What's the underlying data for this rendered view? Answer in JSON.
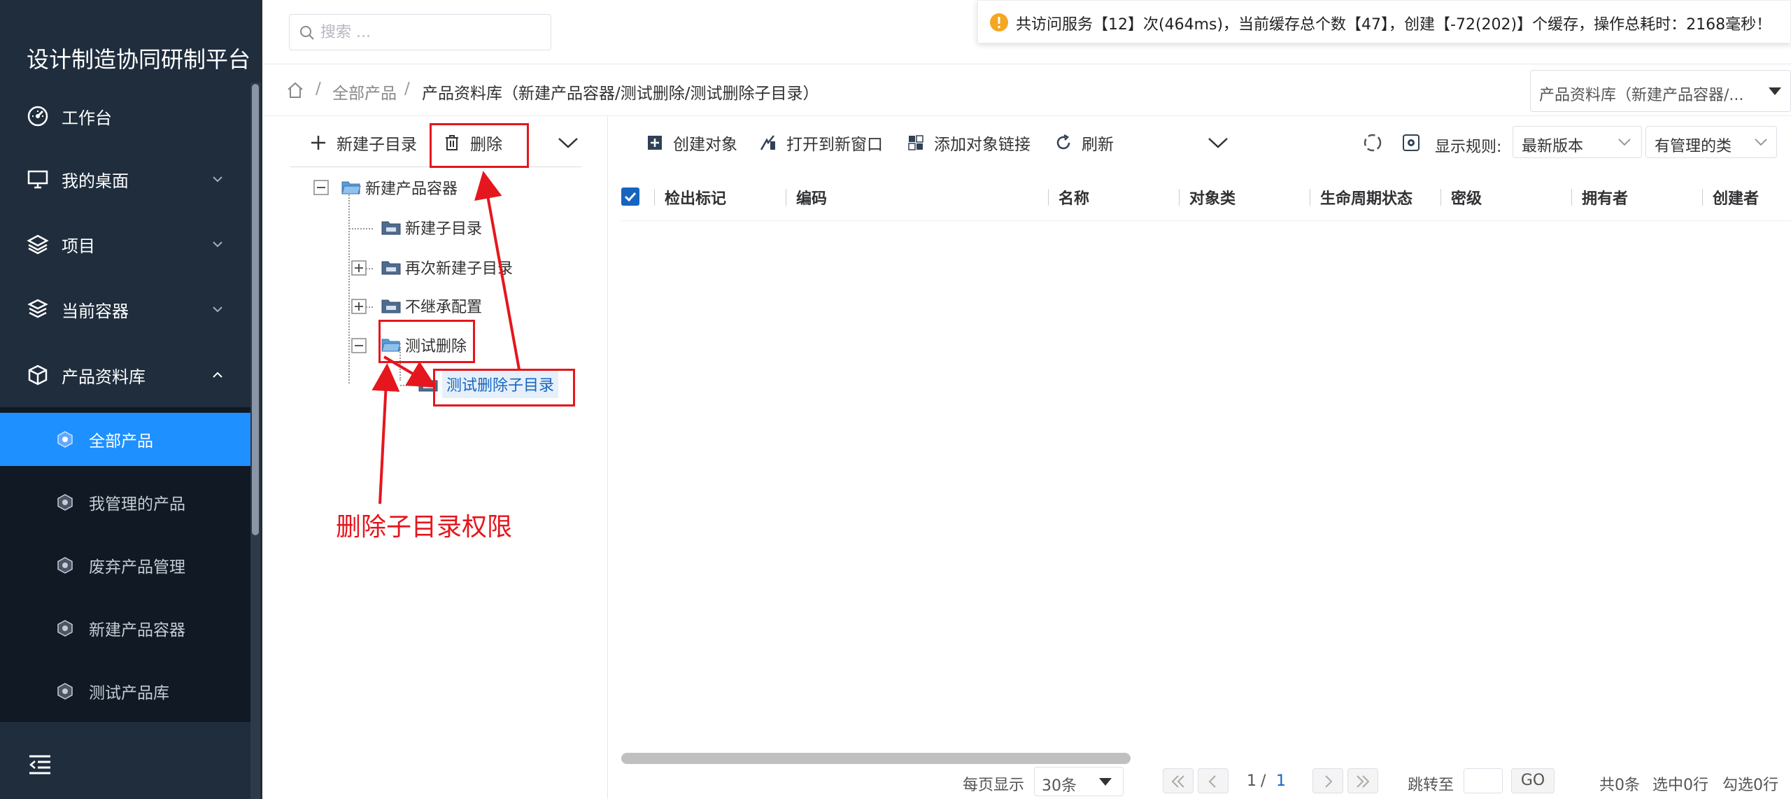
{
  "sidebar": {
    "brand": "设计制造协同研制平台",
    "menu": [
      {
        "label": "工作台",
        "icon": "dashboard-icon"
      },
      {
        "label": "我的桌面",
        "icon": "monitor-icon"
      },
      {
        "label": "项目",
        "icon": "layers-icon"
      },
      {
        "label": "当前容器",
        "icon": "stack-icon"
      },
      {
        "label": "产品资料库",
        "icon": "cube-icon"
      }
    ],
    "submenu": [
      {
        "label": "全部产品",
        "active": true
      },
      {
        "label": "我管理的产品"
      },
      {
        "label": "废弃产品管理"
      },
      {
        "label": "新建产品容器"
      },
      {
        "label": "测试产品库"
      }
    ]
  },
  "topbar": {
    "search_placeholder": "搜索 ...",
    "notice": "共访问服务【12】次(464ms)，当前缓存总个数【47】，创建【-72(202)】个缓存，操作总耗时：2168毫秒！"
  },
  "breadcrumb": {
    "sep": "/",
    "root": "全部产品",
    "current": "产品资料库（新建产品容器/测试删除/测试删除子目录）",
    "container_select": "产品资料库（新建产品容器/..."
  },
  "tree": {
    "toolbar": {
      "new_subdir": "新建子目录",
      "delete": "删除"
    },
    "nodes": {
      "root": "新建产品容器",
      "child1": "新建子目录",
      "child2": "再次新建子目录",
      "child3": "不继承配置",
      "child4": "测试删除",
      "grandchild": "测试删除子目录"
    }
  },
  "annotation": {
    "label": "删除子目录权限",
    "color": "#e5161d"
  },
  "main": {
    "toolbar": {
      "create_object": "创建对象",
      "open_new_window": "打开到新窗口",
      "add_object_link": "添加对象链接",
      "refresh": "刷新",
      "display_rule_label": "显示规则:",
      "version_select": "最新版本",
      "class_select": "有管理的类"
    },
    "table": {
      "columns": [
        "检出标记",
        "编码",
        "名称",
        "对象类",
        "生命周期状态",
        "密级",
        "拥有者",
        "创建者"
      ]
    },
    "pager": {
      "per_page_label": "每页显示",
      "per_page_value": "30条",
      "page_current": "1",
      "page_sep": "/",
      "page_total": "1",
      "jump_label": "跳转至",
      "go": "GO",
      "total": "共0条",
      "selected_rows": "选中0行",
      "checked_rows": "勾选0行"
    }
  },
  "colors": {
    "sidebar_bg": "#1f2d3d",
    "active": "#1e90ff",
    "accent": "#1565c0",
    "annotation": "#e5161d"
  }
}
